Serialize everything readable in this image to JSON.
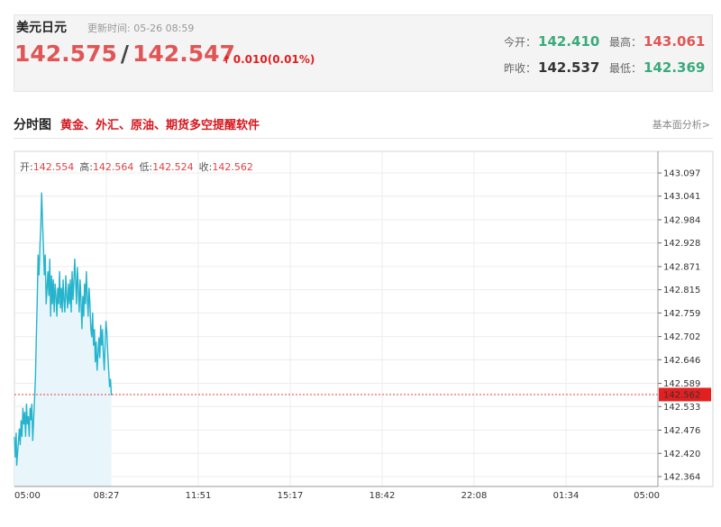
{
  "quote": {
    "name": "美元日元",
    "update_time": "更新时间: 05-26 08:59",
    "bid": "142.575",
    "ask": "142.547",
    "change": "0.010(0.01%)",
    "today_open_label": "今开：",
    "today_open": "142.410",
    "high_label": "最高：",
    "high": "143.061",
    "prev_close_label": "昨收：",
    "prev_close": "142.537",
    "low_label": "最低：",
    "low": "142.369"
  },
  "section": {
    "title": "分时图",
    "promo": "黄金、外汇、原油、期货多空提醒软件",
    "analysis_link": "基本面分析>"
  },
  "ohlc": {
    "open_label": "开:",
    "open": "142.554",
    "high_label": "高:",
    "high": "142.564",
    "low_label": "低:",
    "low": "142.524",
    "close_label": "收:",
    "close": "142.562"
  },
  "colors": {
    "line": "#26b4cc",
    "area": "#e8f6fb",
    "ref_line": "#e04040",
    "price_tag": "#e32020",
    "up": "#e05555",
    "down": "#3aaa7a"
  },
  "chart_data": {
    "type": "line",
    "title": "",
    "xlabel": "",
    "ylabel": "",
    "x_ticks": [
      "05:00",
      "08:27",
      "11:51",
      "15:17",
      "18:42",
      "22:08",
      "01:34",
      "05:00"
    ],
    "y_ticks": [
      "143.097",
      "143.041",
      "142.984",
      "142.928",
      "142.871",
      "142.815",
      "142.759",
      "142.702",
      "142.646",
      "142.589",
      "142.533",
      "142.476",
      "142.420",
      "142.364"
    ],
    "ylim": [
      142.364,
      143.097
    ],
    "x_span_minutes": 1440,
    "current_price": "142.562",
    "current_price_value": 142.562,
    "grid": true,
    "series": [
      {
        "minutes": [
          0,
          2,
          4,
          5,
          7,
          9,
          11,
          13,
          15,
          17,
          19,
          21,
          23,
          25,
          27,
          29,
          31,
          33,
          35,
          37,
          39,
          41,
          43,
          45,
          47,
          49,
          51,
          53,
          55,
          57,
          59,
          61,
          63,
          65,
          67,
          69,
          71,
          73,
          75,
          77,
          79,
          81,
          83,
          85,
          87,
          89,
          91,
          93,
          95,
          97,
          99,
          101,
          103,
          105,
          107,
          109,
          111,
          113,
          115,
          117,
          119,
          121,
          123,
          125,
          127,
          129,
          131,
          133,
          135,
          137,
          139,
          141,
          143,
          145,
          147,
          149,
          151,
          153,
          155,
          157,
          159,
          161,
          163,
          165,
          167,
          169,
          171,
          173,
          175,
          177,
          179,
          181,
          183,
          185,
          187,
          189,
          191,
          193,
          195,
          197,
          199,
          201,
          203,
          205,
          207,
          209,
          211,
          213,
          215,
          217
        ],
        "values": [
          142.46,
          142.41,
          142.47,
          142.39,
          142.42,
          142.45,
          142.48,
          142.44,
          142.5,
          142.46,
          142.53,
          142.49,
          142.52,
          142.46,
          142.54,
          142.49,
          142.51,
          142.46,
          142.53,
          142.5,
          142.54,
          142.45,
          142.5,
          142.55,
          142.6,
          142.7,
          142.79,
          142.9,
          142.85,
          142.92,
          142.97,
          143.05,
          142.98,
          142.92,
          142.85,
          142.9,
          142.78,
          142.82,
          142.86,
          142.8,
          142.89,
          142.75,
          142.85,
          142.78,
          142.84,
          142.76,
          142.83,
          142.8,
          142.75,
          142.82,
          142.78,
          142.86,
          142.77,
          142.82,
          142.76,
          142.84,
          142.79,
          142.76,
          142.85,
          142.8,
          142.77,
          142.83,
          142.78,
          142.84,
          142.76,
          142.86,
          142.79,
          142.83,
          142.89,
          142.84,
          142.78,
          142.87,
          142.82,
          142.76,
          142.84,
          142.79,
          142.72,
          142.8,
          142.75,
          142.83,
          142.78,
          142.86,
          142.8,
          142.75,
          142.82,
          142.78,
          142.72,
          142.7,
          142.76,
          142.68,
          142.72,
          142.64,
          142.69,
          142.62,
          142.66,
          142.7,
          142.65,
          142.73,
          142.68,
          142.72,
          142.66,
          142.62,
          142.69,
          142.74,
          142.71,
          142.66,
          142.62,
          142.58,
          142.6,
          142.56
        ]
      }
    ]
  }
}
